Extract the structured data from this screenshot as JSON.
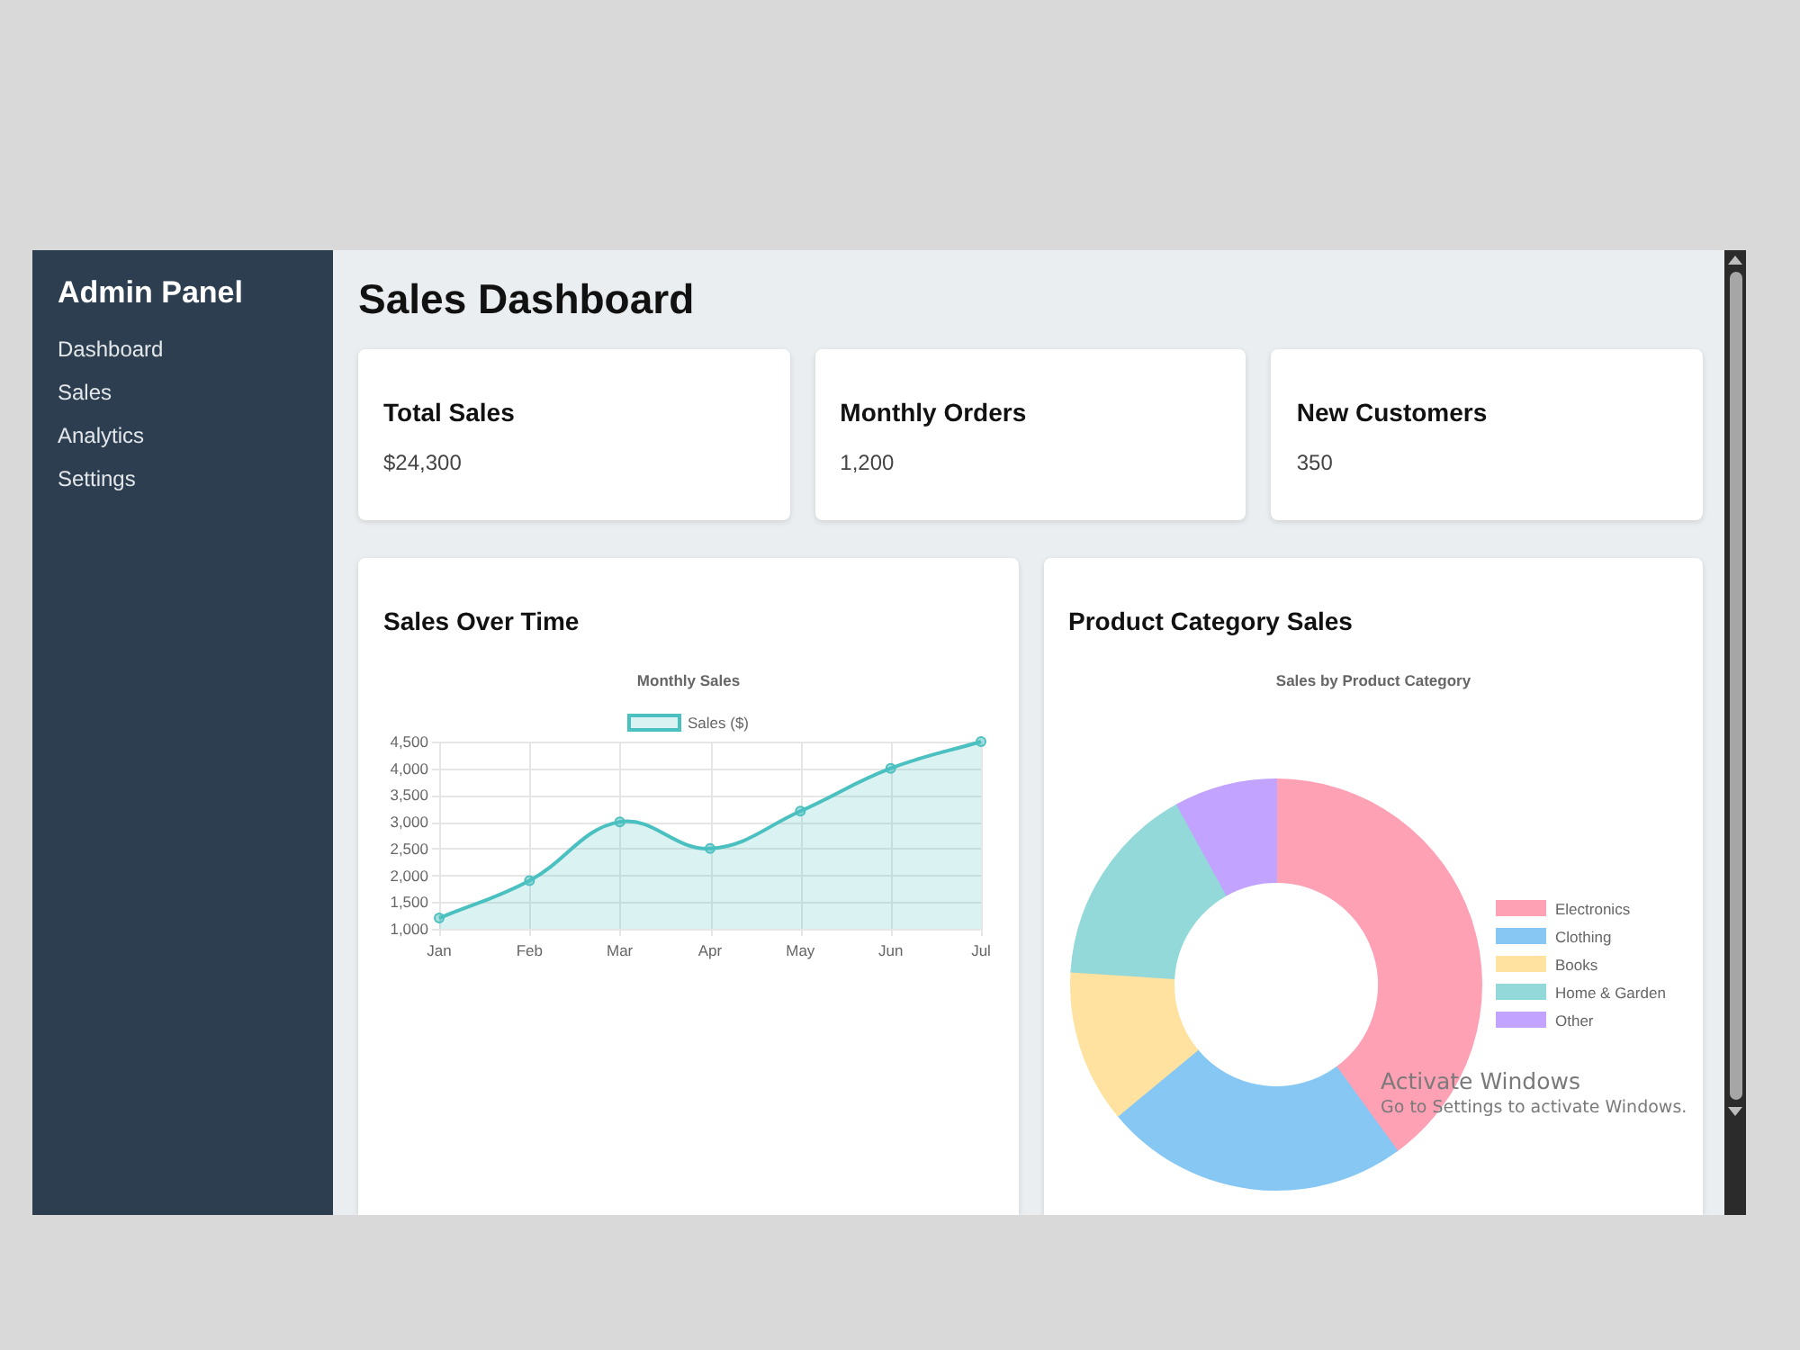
{
  "sidebar": {
    "title": "Admin Panel",
    "items": [
      "Dashboard",
      "Sales",
      "Analytics",
      "Settings"
    ]
  },
  "page": {
    "title": "Sales Dashboard"
  },
  "stats": [
    {
      "title": "Total Sales",
      "value": "$24,300"
    },
    {
      "title": "Monthly Orders",
      "value": "1,200"
    },
    {
      "title": "New Customers",
      "value": "350"
    }
  ],
  "sales_over_time": {
    "title": "Sales Over Time",
    "chart_data": {
      "type": "area",
      "title": "Monthly Sales",
      "grid": true,
      "categories": [
        "Jan",
        "Feb",
        "Mar",
        "Apr",
        "May",
        "Jun",
        "Jul"
      ],
      "series": [
        {
          "name": "Sales ($)",
          "color": "#4bc0c0",
          "values": [
            1200,
            1900,
            3000,
            2500,
            3200,
            4000,
            4500
          ]
        }
      ],
      "ylim": [
        1000,
        4500
      ],
      "yticks": [
        {
          "value": 1000,
          "label": "1,000"
        },
        {
          "value": 1500,
          "label": "1,500"
        },
        {
          "value": 2000,
          "label": "2,000"
        },
        {
          "value": 2500,
          "label": "2,500"
        },
        {
          "value": 3000,
          "label": "3,000"
        },
        {
          "value": 3500,
          "label": "3,500"
        },
        {
          "value": 4000,
          "label": "4,000"
        },
        {
          "value": 4500,
          "label": "4,500"
        }
      ]
    }
  },
  "product_category_sales": {
    "title": "Product Category Sales",
    "chart_title": "Sales by Product Category",
    "legend": [
      {
        "label": "Electronics",
        "color": "#ffa1b5"
      },
      {
        "label": "Clothing",
        "color": "#86c7f3"
      },
      {
        "label": "Books",
        "color": "#ffe29f"
      },
      {
        "label": "Home & Garden",
        "color": "#93d9d9"
      },
      {
        "label": "Other",
        "color": "#c2a3ff"
      }
    ]
  },
  "activation_notice": {
    "title": "Activate Windows",
    "text": "Go to Settings to activate Windows."
  }
}
